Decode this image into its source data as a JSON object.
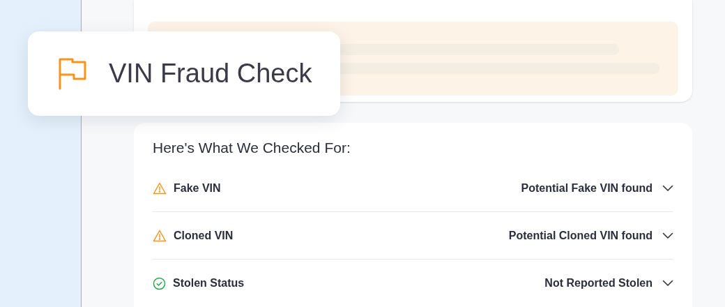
{
  "badge": {
    "title": "VIN Fraud Check"
  },
  "checks": {
    "heading": "Here's What We Checked For:",
    "items": [
      {
        "label": "Fake VIN",
        "kind": "warning",
        "result": "Potential Fake VIN found",
        "expanded": false
      },
      {
        "label": "Cloned VIN",
        "kind": "warning",
        "result": "Potential Cloned VIN found",
        "expanded": false
      },
      {
        "label": "Stolen Status",
        "kind": "ok",
        "result": "Not Reported Stolen",
        "expanded": false
      }
    ]
  }
}
